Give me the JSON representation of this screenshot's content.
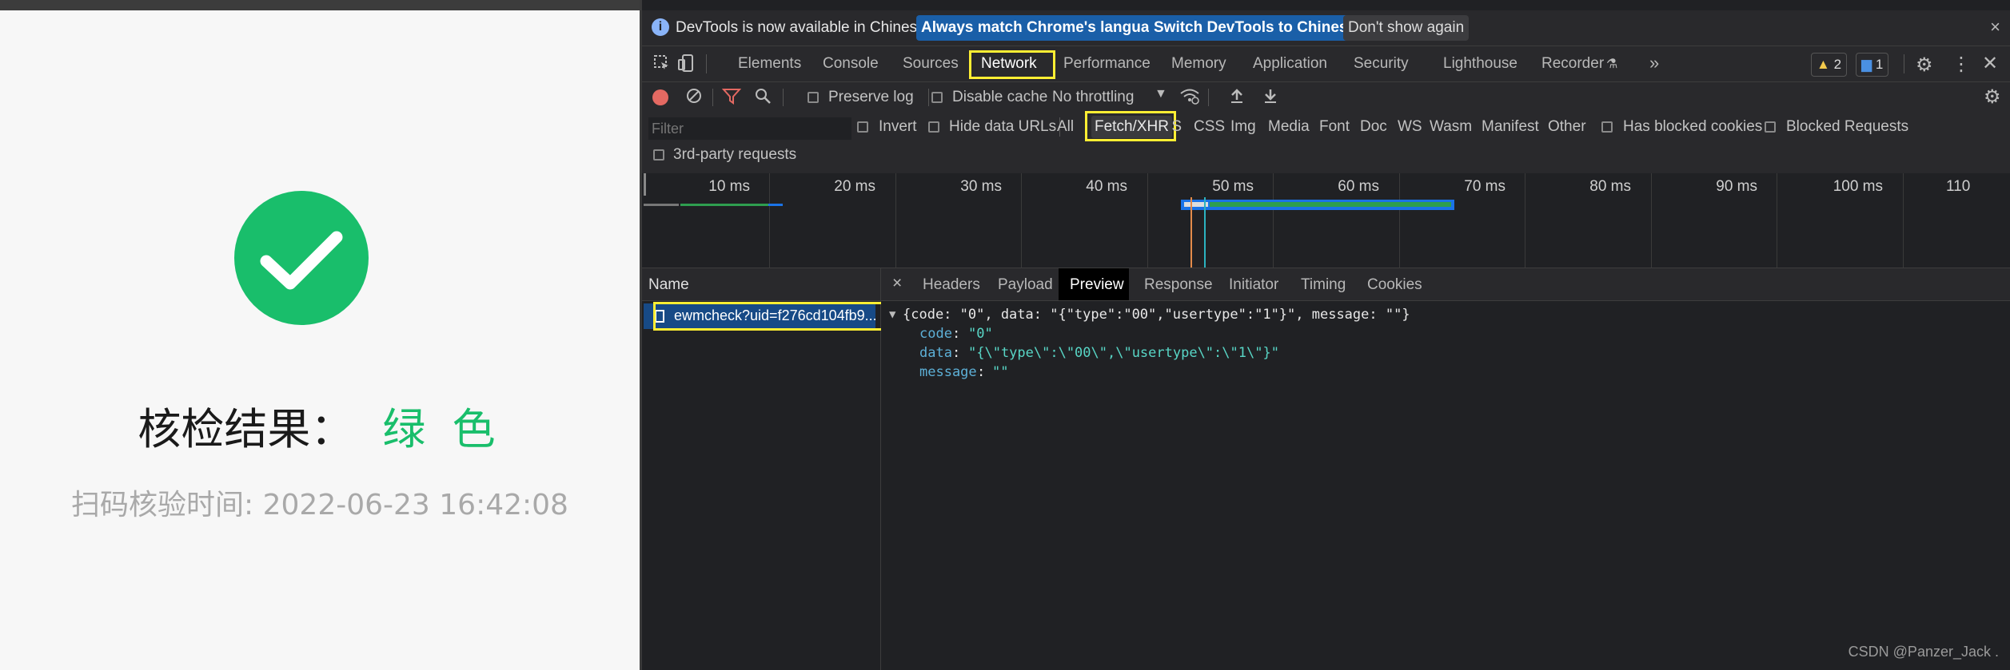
{
  "page": {
    "result_label": "核检结果：",
    "result_value": "绿 色",
    "scan_time": "扫码核验时间: 2022-06-23 16:42:08",
    "colors": {
      "green": "#19be6b"
    }
  },
  "devtools": {
    "infobar": {
      "icon": "info-icon",
      "message": "DevTools is now available in Chinese!",
      "btn_match": "Always match Chrome's language",
      "btn_switch": "Switch DevTools to Chinese",
      "btn_dont_show": "Don't show again",
      "close": "×"
    },
    "tabs": [
      "Elements",
      "Console",
      "Sources",
      "Network",
      "Performance",
      "Memory",
      "Application",
      "Security",
      "Lighthouse",
      "Recorder"
    ],
    "active_tab": "Network",
    "more": "»",
    "warnings": "2",
    "messages": "1",
    "toolbar": {
      "preserve_log": "Preserve log",
      "disable_cache": "Disable cache",
      "throttling": "No throttling"
    },
    "filter": {
      "placeholder": "Filter",
      "invert": "Invert",
      "hide_data_urls": "Hide data URLs",
      "types": [
        "All",
        "Fetch/XHR",
        "JS",
        "CSS",
        "Img",
        "Media",
        "Font",
        "Doc",
        "WS",
        "Wasm",
        "Manifest",
        "Other"
      ],
      "active_type": "Fetch/XHR",
      "has_blocked_cookies": "Has blocked cookies",
      "blocked_requests": "Blocked Requests",
      "third_party": "3rd-party requests"
    },
    "timeline_ticks": [
      "10 ms",
      "20 ms",
      "30 ms",
      "40 ms",
      "50 ms",
      "60 ms",
      "70 ms",
      "80 ms",
      "90 ms",
      "100 ms",
      "110"
    ],
    "name_header": "Name",
    "request": "ewmcheck?uid=f276cd104fb9...",
    "detail_close": "×",
    "detail_tabs": [
      "Headers",
      "Payload",
      "Preview",
      "Response",
      "Initiator",
      "Timing",
      "Cookies"
    ],
    "active_detail_tab": "Preview",
    "preview": {
      "summary": "{code: \"0\", data: \"{\"type\":\"00\",\"usertype\":\"1\"}\", message: \"\"}",
      "code_key": "code",
      "code_val": "\"0\"",
      "data_key": "data",
      "data_val": "\"{\\\"type\\\":\\\"00\\\",\\\"usertype\\\":\\\"1\\\"}\"",
      "message_key": "message",
      "message_val": "\"\""
    },
    "watermark": "CSDN @Panzer_Jack ."
  }
}
